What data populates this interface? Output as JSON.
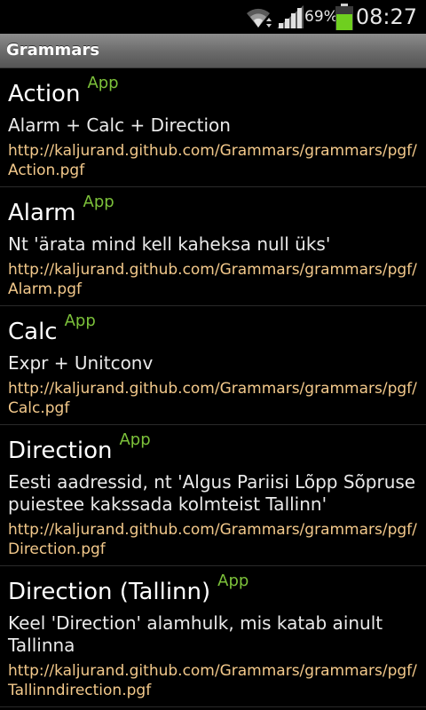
{
  "status": {
    "battery_percent": "69%",
    "battery_level": 0.69,
    "time": "08:27"
  },
  "header": {
    "title": "Grammars"
  },
  "items": [
    {
      "name": "Action",
      "badge": "App",
      "description": "Alarm + Calc + Direction",
      "url": "http://kaljurand.github.com/Grammars/grammars/pgf/Action.pgf"
    },
    {
      "name": "Alarm",
      "badge": "App",
      "description": "Nt 'ärata mind kell kaheksa null üks'",
      "url": "http://kaljurand.github.com/Grammars/grammars/pgf/Alarm.pgf"
    },
    {
      "name": "Calc",
      "badge": "App",
      "description": "Expr + Unitconv",
      "url": "http://kaljurand.github.com/Grammars/grammars/pgf/Calc.pgf"
    },
    {
      "name": "Direction",
      "badge": "App",
      "description": "Eesti aadressid, nt 'Algus Pariisi Lõpp Sõpruse puiestee kakssada kolmteist Tallinn'",
      "url": "http://kaljurand.github.com/Grammars/grammars/pgf/Direction.pgf"
    },
    {
      "name": "Direction (Tallinn)",
      "badge": "App",
      "description": "Keel 'Direction' alamhulk, mis katab ainult Tallinna",
      "url": "http://kaljurand.github.com/Grammars/grammars/pgf/Tallinndirection.pgf"
    }
  ]
}
